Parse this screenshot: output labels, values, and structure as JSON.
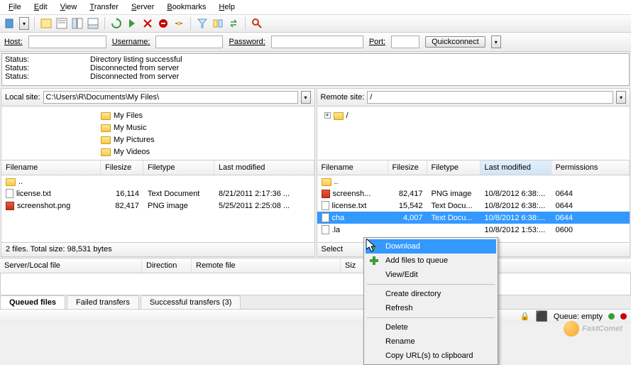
{
  "menu": [
    "File",
    "Edit",
    "View",
    "Transfer",
    "Server",
    "Bookmarks",
    "Help"
  ],
  "quick": {
    "host_label": "Host:",
    "user_label": "Username:",
    "pass_label": "Password:",
    "port_label": "Port:",
    "connect_label": "Quickconnect"
  },
  "status_lines": [
    {
      "label": "Status:",
      "msg": "Directory listing successful"
    },
    {
      "label": "Status:",
      "msg": "Disconnected from server"
    },
    {
      "label": "Status:",
      "msg": "Disconnected from server"
    }
  ],
  "local": {
    "site_label": "Local site:",
    "path": "C:\\Users\\R\\Documents\\My Files\\",
    "tree": [
      "My Files",
      "My Music",
      "My Pictures",
      "My Videos"
    ],
    "headers": [
      "Filename",
      "Filesize",
      "Filetype",
      "Last modified"
    ],
    "rows": [
      {
        "icon": "folder",
        "name": "..",
        "size": "",
        "type": "",
        "mod": ""
      },
      {
        "icon": "file",
        "name": "license.txt",
        "size": "16,114",
        "type": "Text Document",
        "mod": "8/21/2011 2:17:36 ..."
      },
      {
        "icon": "img",
        "name": "screenshot.png",
        "size": "82,417",
        "type": "PNG image",
        "mod": "5/25/2011 2:25:08 ..."
      }
    ],
    "status": "2 files. Total size: 98,531 bytes"
  },
  "remote": {
    "site_label": "Remote site:",
    "path": "/",
    "tree_root": "/",
    "headers": [
      "Filename",
      "Filesize",
      "Filetype",
      "Last modified",
      "Permissions"
    ],
    "sorted_col": 3,
    "rows": [
      {
        "icon": "folder",
        "name": "..",
        "size": "",
        "type": "",
        "mod": "",
        "perm": ""
      },
      {
        "icon": "img",
        "name": "screensh...",
        "size": "82,417",
        "type": "PNG image",
        "mod": "10/8/2012 6:38:...",
        "perm": "0644"
      },
      {
        "icon": "file",
        "name": "license.txt",
        "size": "15,542",
        "type": "Text Docu...",
        "mod": "10/8/2012 6:38:...",
        "perm": "0644"
      },
      {
        "icon": "file",
        "name": "cha",
        "size": "4,007",
        "type": "Text Docu...",
        "mod": "10/8/2012 6:38:...",
        "perm": "0644",
        "selected": true
      },
      {
        "icon": "file",
        "name": ".la",
        "size": "",
        "type": "",
        "mod": "10/8/2012 1:53:...",
        "perm": "0600"
      }
    ],
    "status": "Select"
  },
  "queue": {
    "headers": [
      "Server/Local file",
      "Direction",
      "Remote file",
      "Siz"
    ],
    "tabs": [
      "Queued files",
      "Failed transfers",
      "Successful transfers (3)"
    ],
    "active_tab": 0
  },
  "footer": {
    "queue_label": "Queue: empty"
  },
  "contextmenu": {
    "items": [
      {
        "label": "Download",
        "icon": "download",
        "hl": true
      },
      {
        "label": "Add files to queue",
        "icon": "add"
      },
      {
        "label": "View/Edit"
      },
      {
        "sep": true
      },
      {
        "label": "Create directory"
      },
      {
        "label": "Refresh"
      },
      {
        "sep": true
      },
      {
        "label": "Delete"
      },
      {
        "label": "Rename"
      },
      {
        "label": "Copy URL(s) to clipboard"
      }
    ]
  },
  "watermark": "FastComet"
}
